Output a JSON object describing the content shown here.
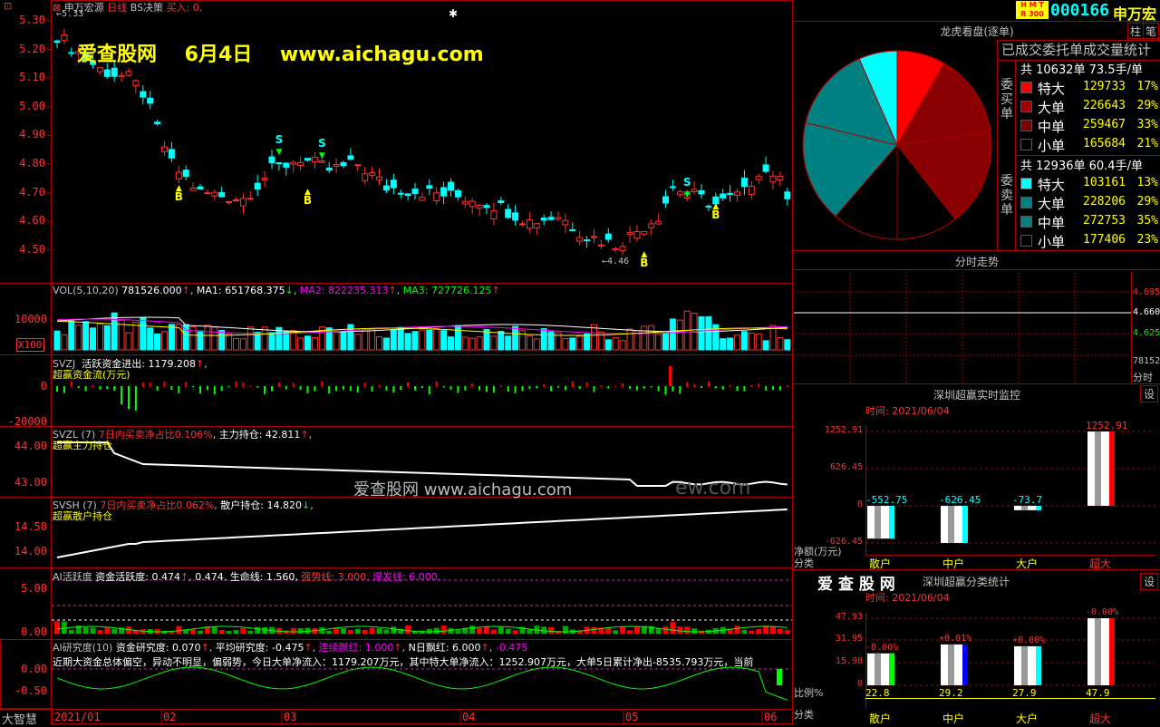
{
  "header": {
    "stock_name": "申万宏源",
    "period": "日线",
    "strategy": "BS决策",
    "buy_label": "买入: 0,",
    "max_price": "5.33",
    "min_price": "4.46"
  },
  "watermark": {
    "site_cn": "爱查股网",
    "date": "6月4日",
    "url": "www.aichagu.com",
    "center": "爱查股网   www.aichagu.com",
    "center_tail": "ew.com"
  },
  "price_axis": [
    "5.30",
    "5.20",
    "5.10",
    "5.00",
    "4.90",
    "4.80",
    "4.70",
    "4.60",
    "4.50"
  ],
  "bs_signals": {
    "b": "B",
    "s": "S"
  },
  "vol_panel": {
    "name": "VOL(5,10,20)",
    "value": "781526.000",
    "ma1": "MA1: 651768.375",
    "ma2": "MA2: 822235.313",
    "ma3": "MA3: 727726.125",
    "axis": "10000",
    "unit": "X100"
  },
  "svzj_panel": {
    "name": "SVZJ",
    "label": "活跃资金进出: 1179.208",
    "subtitle": "超赢资金流(万元)",
    "axis": [
      "0",
      "-20000"
    ]
  },
  "svzl_panel": {
    "name": "SVZL (7)",
    "ratio": "7日内买卖净占比0.106%",
    "hold": "主力持仓: 42.811",
    "subtitle": "超赢主力持仓",
    "axis": [
      "44.00",
      "43.00"
    ]
  },
  "svsh_panel": {
    "name": "SVSH (7)",
    "ratio": "7日内买卖净占比0.062%",
    "hold": "散户持仓: 14.820",
    "subtitle": "超赢散户持仓",
    "axis": [
      "14.50",
      "14.00"
    ]
  },
  "ai_active": {
    "name": "AI活跃度",
    "a": "资金活跃度: 0.474",
    "b": "0.474",
    "c": "生命线: 1.560,",
    "d": "强势线: 3.000,",
    "e": "爆发线: 6.000,",
    "axis": [
      "5.00",
      "0.00"
    ]
  },
  "ai_research": {
    "name": "AI研究度(10)",
    "a": "资金研究度: 0.070",
    "b": "平均研究度: -0.475",
    "c": "连续飘红: 1.000",
    "d": "N日飘红: 6.000",
    "e": "-0.475",
    "desc": "近期大资金总体偏空，异动不明显，偏弱势，今日大单净流入：1179.207万元，其中特大单净流入：1252.907万元，大单5日累计净出-8535.793万元，当前",
    "axis": [
      "0.00",
      "-0.50"
    ]
  },
  "bottom_left": "大智慧",
  "dates": [
    "2021/01",
    "02",
    "03",
    "04",
    "05",
    "06"
  ],
  "quote": {
    "badge": [
      "H M T",
      "R 300"
    ],
    "code": "000166",
    "name": "申万宏"
  },
  "tabs": [
    "柱",
    "笔"
  ],
  "longhu": {
    "title": "龙虎看盘(逐单)",
    "subtitle": "已成交委托单成交量统计",
    "buy": {
      "side": "委买单",
      "total": "共 10632单 73.5手/单",
      "rows": [
        {
          "name": "特大",
          "value": "129733",
          "pct": "17%",
          "color": "#ff0000"
        },
        {
          "name": "大单",
          "value": "226643",
          "pct": "29%",
          "color": "#a00000"
        },
        {
          "name": "中单",
          "value": "259467",
          "pct": "33%",
          "color": "#800000"
        },
        {
          "name": "小单",
          "value": "165684",
          "pct": "21%",
          "color": "#000000"
        }
      ]
    },
    "sell": {
      "side": "委卖单",
      "total": "共 12936单 60.4手/单",
      "rows": [
        {
          "name": "特大",
          "value": "103161",
          "pct": "13%",
          "color": "#00ffff"
        },
        {
          "name": "大单",
          "value": "228206",
          "pct": "29%",
          "color": "#008080"
        },
        {
          "name": "中单",
          "value": "272753",
          "pct": "35%",
          "color": "#008080"
        },
        {
          "name": "小单",
          "value": "177406",
          "pct": "23%",
          "color": "#000000"
        }
      ]
    }
  },
  "fenshi": {
    "title": "分时走势",
    "p1": "4.695",
    "p2": "4.660",
    "p3": "4.625",
    "vol": "78152",
    "label": "分时"
  },
  "monitor": {
    "title": "深圳超赢实时监控",
    "btn": "设",
    "time": "时间: 2021/06/04",
    "axis": [
      "1252.91",
      "626.45",
      "0",
      "-626.45"
    ],
    "ylabel": "净额(万元)",
    "xlabel": "分类",
    "bars": [
      {
        "cat": "散户",
        "value": -552.75,
        "label": "-552.75"
      },
      {
        "cat": "中户",
        "value": -626.45,
        "label": "-626.45"
      },
      {
        "cat": "大户",
        "value": -73.7,
        "label": "-73.7"
      },
      {
        "cat": "超大",
        "value": 1252.91,
        "label": "1252.91"
      }
    ]
  },
  "classify": {
    "brand": "爱 查 股 网",
    "title": "深圳超赢分类统计",
    "btn": "设",
    "time": "时间: 2021/06/04",
    "axis": [
      "47.93",
      "31.95",
      "15.98",
      "0"
    ],
    "ylabel": "比例%",
    "xlabel": "分类",
    "bars": [
      {
        "cat": "散户",
        "value": 22.8,
        "label": "22.8",
        "top": "-0.00%",
        "color": "#00ff00"
      },
      {
        "cat": "中户",
        "value": 29.2,
        "label": "29.2",
        "top": "+0.01%",
        "color": "#0000ff"
      },
      {
        "cat": "大户",
        "value": 27.9,
        "label": "27.9",
        "top": "+0.00%",
        "color": "#00ffff"
      },
      {
        "cat": "超大",
        "value": 47.9,
        "label": "47.9",
        "top": "-0.00%",
        "color": "#ff0000"
      }
    ]
  },
  "colors": {
    "up": "#ff3232",
    "down": "#00ffff",
    "grid": "#aa0000",
    "bg": "#000000"
  }
}
